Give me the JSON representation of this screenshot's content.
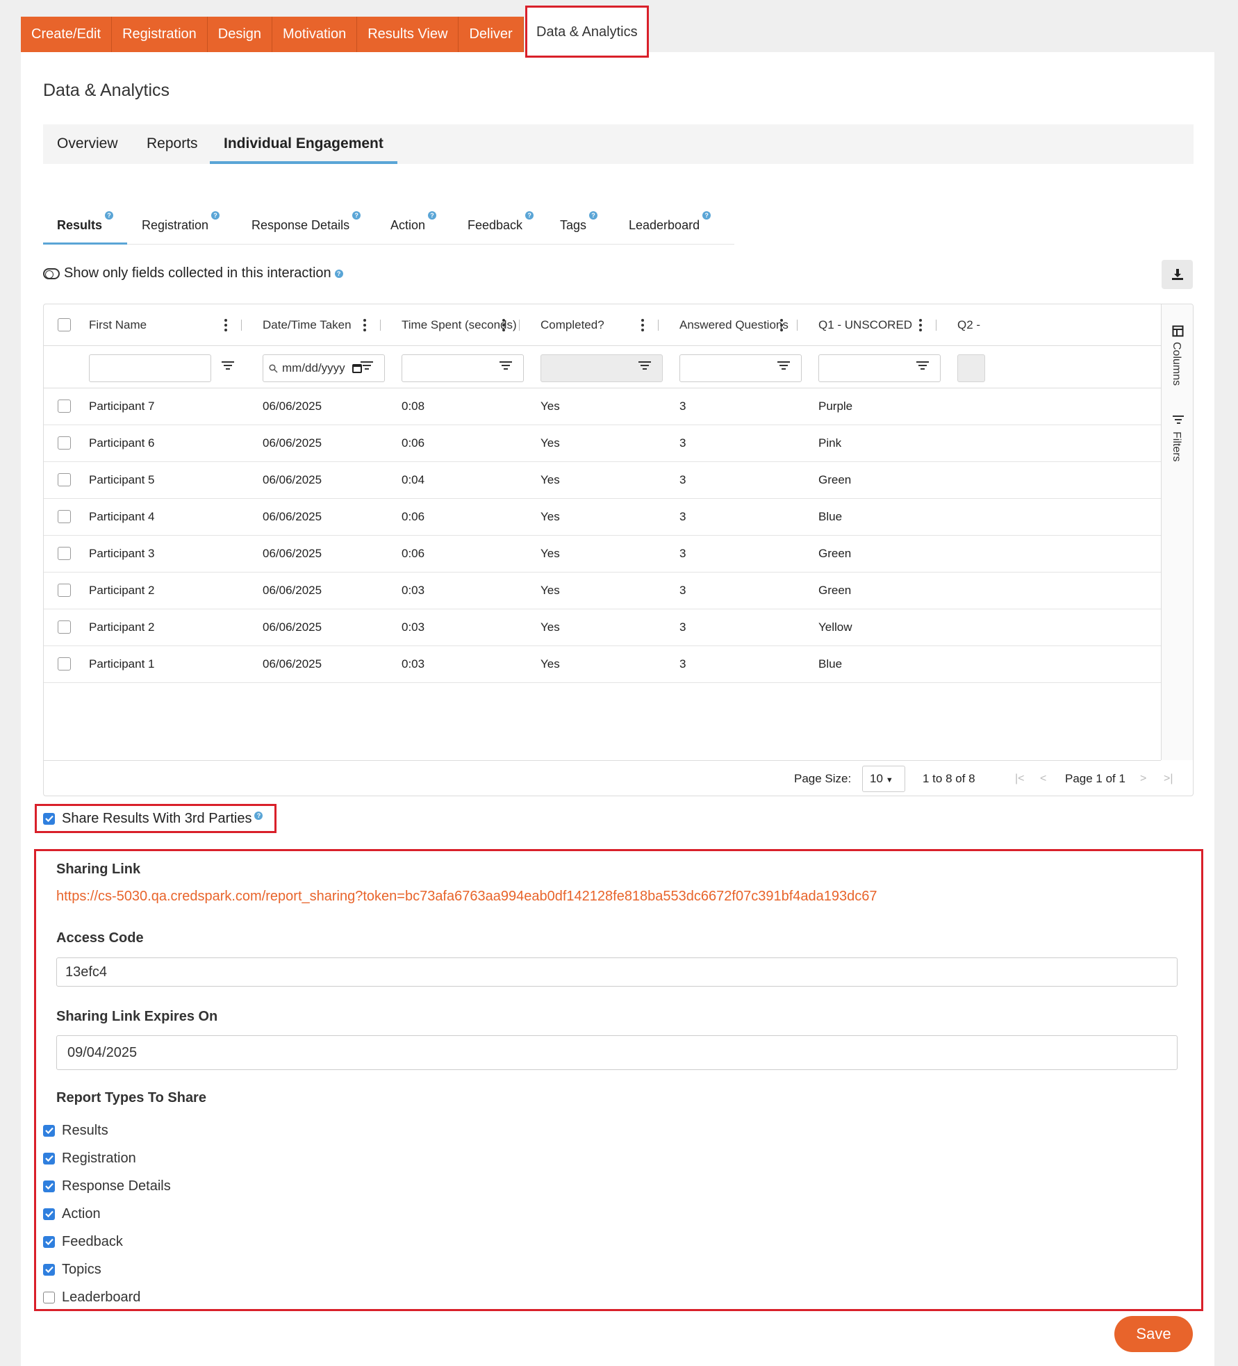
{
  "top_tabs": [
    "Create/Edit",
    "Registration",
    "Design",
    "Motivation",
    "Results View",
    "Deliver"
  ],
  "top_tab_active": "Data & Analytics",
  "page_title": "Data & Analytics",
  "section_tabs": [
    "Overview",
    "Reports",
    "Individual Engagement"
  ],
  "section_tab_active": "Individual Engagement",
  "report_tabs": [
    "Results",
    "Registration",
    "Response Details",
    "Action",
    "Feedback",
    "Tags",
    "Leaderboard"
  ],
  "report_tab_active": "Results",
  "toggle_label": "Show only fields collected in this interaction",
  "grid": {
    "columns": [
      "First Name",
      "Date/Time Taken",
      "Time Spent (seconds)",
      "Completed?",
      "Answered Questions",
      "Q1 - UNSCORED",
      "Q2 -"
    ],
    "date_placeholder": "mm/dd/yyyy",
    "side_columns": "Columns",
    "side_filters": "Filters",
    "rows": [
      [
        "Participant 7",
        "06/06/2025",
        "0:08",
        "Yes",
        "3",
        "Purple"
      ],
      [
        "Participant 6",
        "06/06/2025",
        "0:06",
        "Yes",
        "3",
        "Pink"
      ],
      [
        "Participant 5",
        "06/06/2025",
        "0:04",
        "Yes",
        "3",
        "Green"
      ],
      [
        "Participant 4",
        "06/06/2025",
        "0:06",
        "Yes",
        "3",
        "Blue"
      ],
      [
        "Participant 3",
        "06/06/2025",
        "0:06",
        "Yes",
        "3",
        "Green"
      ],
      [
        "Participant 2",
        "06/06/2025",
        "0:03",
        "Yes",
        "3",
        "Green"
      ],
      [
        "Participant 2",
        "06/06/2025",
        "0:03",
        "Yes",
        "3",
        "Yellow"
      ],
      [
        "Participant 1",
        "06/06/2025",
        "0:03",
        "Yes",
        "3",
        "Blue"
      ]
    ],
    "pager": {
      "page_size_label": "Page Size:",
      "page_size": "10",
      "range": "1 to 8 of 8",
      "page": "Page 1 of 1"
    }
  },
  "share": {
    "checkbox_label": "Share Results With 3rd Parties",
    "checked": true,
    "link_label": "Sharing Link",
    "link": "https://cs-5030.qa.credspark.com/report_sharing?token=bc73afa6763aa994eab0df142128fe818ba553dc6672f07c391bf4ada193dc67",
    "access_code_label": "Access Code",
    "access_code": "13efc4",
    "expires_label": "Sharing Link Expires On",
    "expires": "09/04/2025",
    "report_types_label": "Report Types To Share",
    "report_types": [
      {
        "label": "Results",
        "checked": true
      },
      {
        "label": "Registration",
        "checked": true
      },
      {
        "label": "Response Details",
        "checked": true
      },
      {
        "label": "Action",
        "checked": true
      },
      {
        "label": "Feedback",
        "checked": true
      },
      {
        "label": "Topics",
        "checked": true
      },
      {
        "label": "Leaderboard",
        "checked": false
      }
    ]
  },
  "save_label": "Save",
  "colors": {
    "accent": "#e8642b",
    "highlight": "#d9202a",
    "tab_underline": "#5aa5d6",
    "checkbox": "#2f7fde"
  }
}
